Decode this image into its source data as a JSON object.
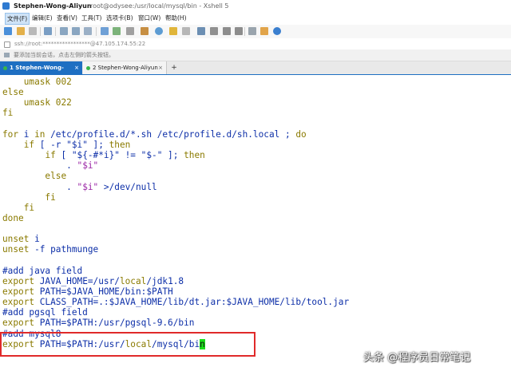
{
  "window": {
    "title_app": "Stephen-Wong-Aliyun",
    "title_path": "root@odysee:/usr/local/mysql/bin - Xshell 5"
  },
  "menu": [
    "文件(F)",
    "编辑(E)",
    "查看(V)",
    "工具(T)",
    "选项卡(B)",
    "窗口(W)",
    "帮助(H)"
  ],
  "address": {
    "text": "ssh://root:*****************@47.105.174.55:22"
  },
  "hint": {
    "text": "要添加当前会话，点击左侧的箭头按钮。"
  },
  "tabs": [
    {
      "label": "1 Stephen-Wong-Aliyun",
      "close": "×",
      "dot_color": "#38b54a"
    },
    {
      "label": "2 Stephen-Wong-Aliyun",
      "close": "×",
      "dot_color": "#38b54a"
    }
  ],
  "add_tab": "+",
  "terminal": {
    "lines": [
      [
        {
          "t": "    umask 002",
          "c": "c-kw"
        }
      ],
      [
        {
          "t": "else",
          "c": "c-kw"
        }
      ],
      [
        {
          "t": "    umask 022",
          "c": "c-kw"
        }
      ],
      [
        {
          "t": "fi",
          "c": "c-kw"
        }
      ],
      [
        {
          "t": "",
          "c": "c-plain"
        }
      ],
      [
        {
          "t": "for",
          "c": "c-kw"
        },
        {
          "t": " i ",
          "c": "c-blue"
        },
        {
          "t": "in",
          "c": "c-kw"
        },
        {
          "t": " /etc/profile.d/*.sh /etc/profile.d/sh.local ; ",
          "c": "c-blue"
        },
        {
          "t": "do",
          "c": "c-kw"
        }
      ],
      [
        {
          "t": "    ",
          "c": "c-plain"
        },
        {
          "t": "if",
          "c": "c-kw"
        },
        {
          "t": " [ -r \"$i\" ]; ",
          "c": "c-blue"
        },
        {
          "t": "then",
          "c": "c-kw"
        }
      ],
      [
        {
          "t": "        ",
          "c": "c-plain"
        },
        {
          "t": "if",
          "c": "c-kw"
        },
        {
          "t": " [ \"${-#*i}\" != \"$-\" ]; ",
          "c": "c-blue"
        },
        {
          "t": "then",
          "c": "c-kw"
        }
      ],
      [
        {
          "t": "            . ",
          "c": "c-blue"
        },
        {
          "t": "\"$i\"",
          "c": "c-str"
        }
      ],
      [
        {
          "t": "        else",
          "c": "c-kw"
        }
      ],
      [
        {
          "t": "            . ",
          "c": "c-blue"
        },
        {
          "t": "\"$i\"",
          "c": "c-str"
        },
        {
          "t": " >/dev/null",
          "c": "c-blue"
        }
      ],
      [
        {
          "t": "        fi",
          "c": "c-kw"
        }
      ],
      [
        {
          "t": "    fi",
          "c": "c-kw"
        }
      ],
      [
        {
          "t": "done",
          "c": "c-kw"
        }
      ],
      [
        {
          "t": "",
          "c": "c-plain"
        }
      ],
      [
        {
          "t": "unset",
          "c": "c-kw"
        },
        {
          "t": " i",
          "c": "c-blue"
        }
      ],
      [
        {
          "t": "unset",
          "c": "c-kw"
        },
        {
          "t": " -f pathmunge",
          "c": "c-blue"
        }
      ],
      [
        {
          "t": "",
          "c": "c-plain"
        }
      ],
      [
        {
          "t": "#add java field",
          "c": "c-cm"
        }
      ],
      [
        {
          "t": "export",
          "c": "c-kw"
        },
        {
          "t": " JAVA_HOME=/usr/",
          "c": "c-blue"
        },
        {
          "t": "local",
          "c": "c-kw"
        },
        {
          "t": "/jdk1.8",
          "c": "c-blue"
        }
      ],
      [
        {
          "t": "export",
          "c": "c-kw"
        },
        {
          "t": " PATH=$JAVA_HOME/bin:$PATH",
          "c": "c-blue"
        }
      ],
      [
        {
          "t": "export",
          "c": "c-kw"
        },
        {
          "t": " CLASS_PATH=.:$JAVA_HOME/lib/dt.jar:$JAVA_HOME/lib/tool.jar",
          "c": "c-blue"
        }
      ],
      [
        {
          "t": "#add pgsql field",
          "c": "c-cm"
        }
      ],
      [
        {
          "t": "export",
          "c": "c-kw"
        },
        {
          "t": " PATH=$PATH:/usr/pgsql-9.6/bin",
          "c": "c-blue"
        }
      ],
      [
        {
          "t": "#add mysql8",
          "c": "c-cm"
        }
      ],
      [
        {
          "t": "export",
          "c": "c-kw"
        },
        {
          "t": " PATH=$PATH:/usr/",
          "c": "c-blue"
        },
        {
          "t": "local",
          "c": "c-kw"
        },
        {
          "t": "/mysql/bi",
          "c": "c-blue"
        },
        {
          "t": "n",
          "c": "cursor"
        }
      ]
    ]
  },
  "watermark": "头条 @程序员日常笔记"
}
